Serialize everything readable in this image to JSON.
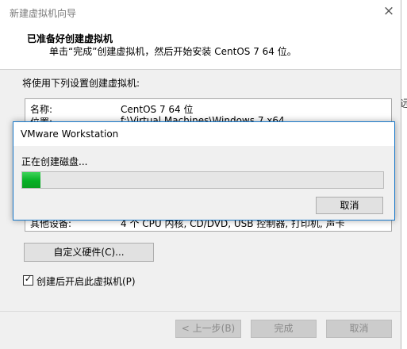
{
  "wizard": {
    "title": "新建虚拟机向导",
    "header_title": "已准备好创建虚拟机",
    "header_subtitle": "单击“完成”创建虚拟机，然后开始安装 CentOS 7 64 位。",
    "settings_label": "将使用下列设置创建虚拟机:",
    "settings": [
      {
        "key": "名称:",
        "value": "CentOS 7 64 位"
      },
      {
        "key": "位置:",
        "value": "f:\\Virtual Machines\\Windows 7 x64"
      },
      {
        "key": "其他设备:",
        "value": "4 个 CPU 内核, CD/DVD, USB 控制器, 打印机, 声卡"
      }
    ],
    "custom_hardware_button": "自定义硬件(C)...",
    "power_on_checkbox": {
      "label": "创建后开启此虚拟机(P)",
      "checked": true,
      "mark": "✓"
    },
    "buttons": {
      "back": "< 上一步(B)",
      "finish": "完成",
      "cancel": "取消"
    },
    "close_icon": "×",
    "edge_text": "远"
  },
  "dialog": {
    "title": "VMware Workstation",
    "message": "正在创建磁盘...",
    "progress": 0.05,
    "cancel": "取消"
  },
  "colors": {
    "progress": "#06b025",
    "dialog_border": "#1979ca"
  }
}
